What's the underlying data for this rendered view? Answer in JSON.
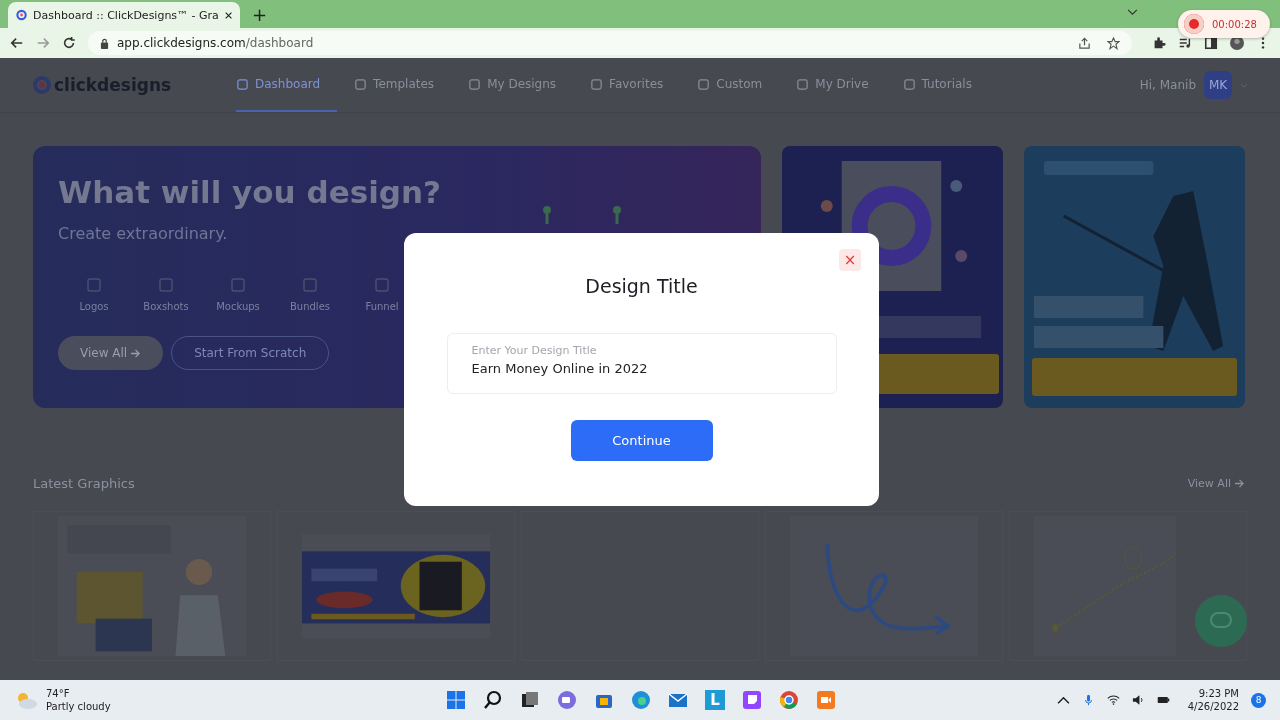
{
  "browser": {
    "tab_title": "Dashboard :: ClickDesigns™ - Gra",
    "new_tab": "+",
    "url_host": "app.clickdesigns.com",
    "url_path": "/dashboard"
  },
  "recorder": {
    "time": "00:00:28"
  },
  "app": {
    "logo": "clickdesigns",
    "nav": [
      {
        "label": "Dashboard",
        "selected": true
      },
      {
        "label": "Templates",
        "selected": false
      },
      {
        "label": "My Designs",
        "selected": false
      },
      {
        "label": "Favorites",
        "selected": false
      },
      {
        "label": "Custom",
        "selected": false
      },
      {
        "label": "My Drive",
        "selected": false
      },
      {
        "label": "Tutorials",
        "selected": false
      }
    ],
    "greeting": "Hi, Manib",
    "avatar": "MK"
  },
  "hero": {
    "title": "What will you design?",
    "subtitle": "Create extraordinary.",
    "categories": [
      "Logos",
      "Boxshots",
      "Mockups",
      "Bundles",
      "Funnel"
    ],
    "buttons": [
      "View All",
      "Start From Scratch"
    ]
  },
  "promos": [
    {
      "kind": "picture"
    },
    {
      "kind": "picture"
    }
  ],
  "latest": {
    "title": "Latest Graphics",
    "view_all": "View All",
    "items": [
      {
        "kind": "picture"
      },
      {
        "kind": "picture"
      },
      {
        "kind": "blank"
      },
      {
        "kind": "picture"
      },
      {
        "kind": "picture"
      }
    ]
  },
  "modal": {
    "title": "Design Title",
    "close": "×",
    "field": {
      "label": "Enter Your Design Title",
      "value": "Earn Money Online in 2022"
    },
    "button": "Continue"
  },
  "taskbar": {
    "temperature": "74°F",
    "weather": "Partly cloudy",
    "app_letter": "L",
    "time": "9:23 PM",
    "date": "4/26/2022",
    "badge": "8"
  }
}
